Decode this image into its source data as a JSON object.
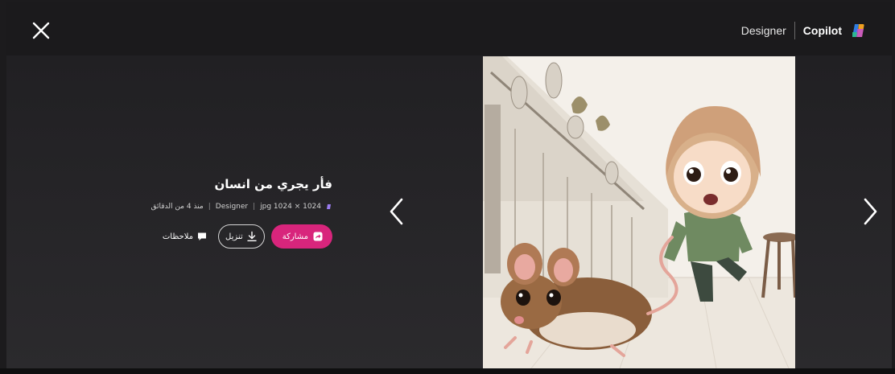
{
  "header": {
    "close_icon": "close-icon",
    "designer_label": "Designer",
    "copilot_label": "Copilot",
    "copilot_logo_icon": "copilot-logo-icon"
  },
  "image_info": {
    "title": "فأر يجري من انسان",
    "meta": {
      "icon": "designer-dot-icon",
      "format": "jpg 1024 × 1024",
      "source": "Designer",
      "time": "منذ 4 من الدقائق"
    },
    "actions": {
      "share_label": "مشاركة",
      "download_label": "تنزيل",
      "notes_label": "ملاحظات"
    }
  },
  "navigation": {
    "prev_icon": "chevron-left-icon",
    "next_icon": "chevron-right-icon"
  },
  "colors": {
    "share_button": "#d8257c",
    "background": "#1c1b1d"
  }
}
